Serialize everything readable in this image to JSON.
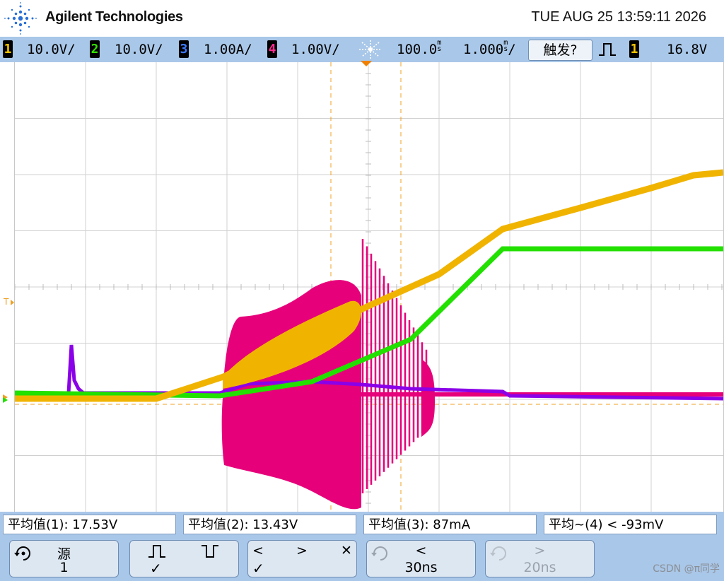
{
  "header": {
    "brand": "Agilent Technologies",
    "datetime": "TUE AUG 25 13:59:11 2026",
    "logo_icon": "agilent-spark-icon"
  },
  "status": {
    "ch1": {
      "num": "1",
      "scale": "10.0V/",
      "color": "#f5c400"
    },
    "ch2": {
      "num": "2",
      "scale": "10.0V/",
      "color": "#33e000"
    },
    "ch3": {
      "num": "3",
      "scale": "1.00A/",
      "color": "#3d7bff"
    },
    "ch4": {
      "num": "4",
      "scale": "1.00V/",
      "color": "#ff2b8f"
    },
    "time_icon": "timebase-icon",
    "time_delay": "100.0",
    "time_scale": "1.000",
    "trigger_btn": "触发?",
    "trig_edge_icon": "rising-edge-icon",
    "trig_ch": "1",
    "trig_level": "16.8V"
  },
  "traces": {
    "ch1_color": "#f0b400",
    "ch2_color": "#22e000",
    "ch3_color": "#8a00e8",
    "ch4_color": "#e6007a"
  },
  "measurements": [
    "平均值(1): 17.53V",
    "平均值(2): 13.43V",
    "平均值(3): 87mA",
    "平均~(4) < -93mV"
  ],
  "softkeys": {
    "source_label": "源",
    "source_value": "1",
    "rising_check": "✓",
    "falling_label": "",
    "nav_check": "✓",
    "prev_label": "<",
    "prev_value": "30ns",
    "next_label": ">",
    "next_value": "20ns"
  },
  "watermark": "CSDN @π同学"
}
